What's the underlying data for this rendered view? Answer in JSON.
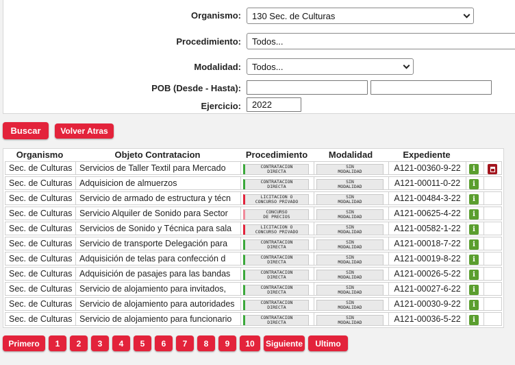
{
  "filters": {
    "organismo": {
      "label": "Organismo:",
      "value": "130 Sec. de Culturas"
    },
    "procedimiento": {
      "label": "Procedimiento:",
      "value": "Todos..."
    },
    "modalidad": {
      "label": "Modalidad:",
      "value": "Todos..."
    },
    "pob": {
      "label": "POB (Desde - Hasta):",
      "desde": "",
      "hasta": ""
    },
    "ejercicio": {
      "label": "Ejercicio:",
      "value": "2022"
    }
  },
  "actions": {
    "buscar": "Buscar",
    "volver": "Volver Atras"
  },
  "table": {
    "headers": [
      "Organismo",
      "Objeto Contratacion",
      "Procedimiento",
      "Modalidad",
      "Expediente"
    ],
    "rows": [
      {
        "organismo": "Sec. de Culturas",
        "objeto": "Servicios de Taller Textil para Mercado",
        "proc1": "CONTRATACION",
        "proc2": "DIRECTA",
        "proc_color": "#3aa83a",
        "mod1": "SIN",
        "mod2": "MODALIDAD",
        "expediente": "A121-00360-9-22",
        "clip": true
      },
      {
        "organismo": "Sec. de Culturas",
        "objeto": "Adquisicion de almuerzos",
        "proc1": "CONTRATACION",
        "proc2": "DIRECTA",
        "proc_color": "#3aa83a",
        "mod1": "SIN",
        "mod2": "MODALIDAD",
        "expediente": "A121-00011-0-22",
        "clip": false
      },
      {
        "organismo": "Sec. de Culturas",
        "objeto": "Servicio de armado de estructura y técn",
        "proc1": "LICITACION O",
        "proc2": "CONCURSO PRIVADO",
        "proc_color": "#e3233b",
        "mod1": "SIN",
        "mod2": "MODALIDAD",
        "expediente": "A121-00484-3-22",
        "clip": false
      },
      {
        "organismo": "Sec. de Culturas",
        "objeto": "Servicio Alquiler de Sonido para Sector",
        "proc1": "CONCURSO",
        "proc2": "DE PRECIOS",
        "proc_color": "#f08a9a",
        "mod1": "SIN",
        "mod2": "MODALIDAD",
        "expediente": "A121-00625-4-22",
        "clip": false
      },
      {
        "organismo": "Sec. de Culturas",
        "objeto": "Servicios de Sonido y Técnica para sala",
        "proc1": "LICITACION O",
        "proc2": "CONCURSO PRIVADO",
        "proc_color": "#e3233b",
        "mod1": "SIN",
        "mod2": "MODALIDAD",
        "expediente": "A121-00582-1-22",
        "clip": false
      },
      {
        "organismo": "Sec. de Culturas",
        "objeto": "Servicio de transporte Delegación para",
        "proc1": "CONTRATACION",
        "proc2": "DIRECTA",
        "proc_color": "#3aa83a",
        "mod1": "SIN",
        "mod2": "MODALIDAD",
        "expediente": "A121-00018-7-22",
        "clip": false
      },
      {
        "organismo": "Sec. de Culturas",
        "objeto": "Adquisición de telas para confección d",
        "proc1": "CONTRATACION",
        "proc2": "DIRECTA",
        "proc_color": "#3aa83a",
        "mod1": "SIN",
        "mod2": "MODALIDAD",
        "expediente": "A121-00019-8-22",
        "clip": false
      },
      {
        "organismo": "Sec. de Culturas",
        "objeto": "Adquisición de pasajes para las bandas",
        "proc1": "CONTRATACION",
        "proc2": "DIRECTA",
        "proc_color": "#3aa83a",
        "mod1": "SIN",
        "mod2": "MODALIDAD",
        "expediente": "A121-00026-5-22",
        "clip": false
      },
      {
        "organismo": "Sec. de Culturas",
        "objeto": "Servicio de alojamiento para invitados,",
        "proc1": "CONTRATACION",
        "proc2": "DIRECTA",
        "proc_color": "#3aa83a",
        "mod1": "SIN",
        "mod2": "MODALIDAD",
        "expediente": "A121-00027-6-22",
        "clip": false
      },
      {
        "organismo": "Sec. de Culturas",
        "objeto": "Servicio de alojamiento para autoridades",
        "proc1": "CONTRATACION",
        "proc2": "DIRECTA",
        "proc_color": "#3aa83a",
        "mod1": "SIN",
        "mod2": "MODALIDAD",
        "expediente": "A121-00030-9-22",
        "clip": false
      },
      {
        "organismo": "Sec. de Culturas",
        "objeto": "Servicio de alojamiento para funcionario",
        "proc1": "CONTRATACION",
        "proc2": "DIRECTA",
        "proc_color": "#3aa83a",
        "mod1": "SIN",
        "mod2": "MODALIDAD",
        "expediente": "A121-00036-5-22",
        "clip": false
      }
    ],
    "info_icon": "info-icon",
    "clip_icon": "clipboard-icon"
  },
  "pagination": [
    "Primero",
    "1",
    "2",
    "3",
    "4",
    "5",
    "6",
    "7",
    "8",
    "9",
    "10",
    "Siguiente",
    "Ultimo"
  ],
  "colors": {
    "accent": "#e3233b",
    "info": "#5a9e2e",
    "clip": "#a3161f"
  }
}
